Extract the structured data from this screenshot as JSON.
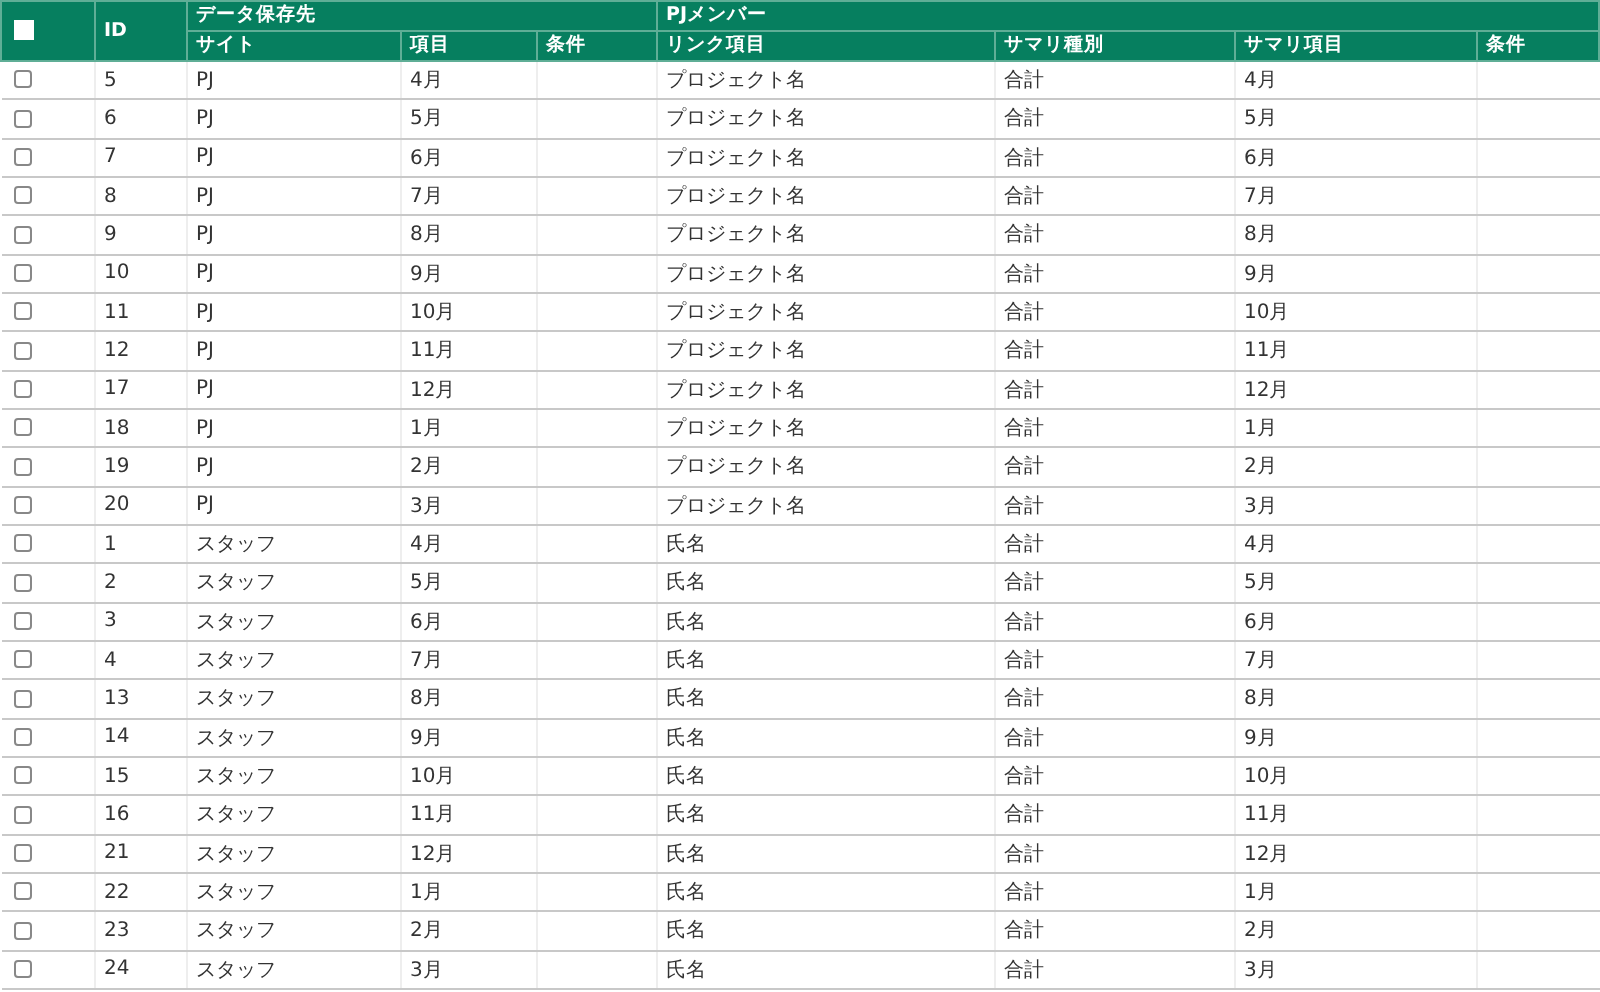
{
  "table": {
    "select_all": {
      "checked": false
    },
    "group_headers": [
      {
        "label": "データ保存先"
      },
      {
        "label": "PJメンバー"
      }
    ],
    "id_header": "ID",
    "columns": [
      "サイト",
      "項目",
      "条件",
      "リンク項目",
      "サマリ種別",
      "サマリ項目",
      "条件"
    ],
    "rows": [
      {
        "checked": false,
        "id": "5",
        "site": "PJ",
        "item": "4月",
        "link": "プロジェクト名",
        "summary_type": "合計",
        "summary_item": "4月"
      },
      {
        "checked": false,
        "id": "6",
        "site": "PJ",
        "item": "5月",
        "link": "プロジェクト名",
        "summary_type": "合計",
        "summary_item": "5月"
      },
      {
        "checked": false,
        "id": "7",
        "site": "PJ",
        "item": "6月",
        "link": "プロジェクト名",
        "summary_type": "合計",
        "summary_item": "6月"
      },
      {
        "checked": false,
        "id": "8",
        "site": "PJ",
        "item": "7月",
        "link": "プロジェクト名",
        "summary_type": "合計",
        "summary_item": "7月"
      },
      {
        "checked": false,
        "id": "9",
        "site": "PJ",
        "item": "8月",
        "link": "プロジェクト名",
        "summary_type": "合計",
        "summary_item": "8月"
      },
      {
        "checked": false,
        "id": "10",
        "site": "PJ",
        "item": "9月",
        "link": "プロジェクト名",
        "summary_type": "合計",
        "summary_item": "9月"
      },
      {
        "checked": false,
        "id": "11",
        "site": "PJ",
        "item": "10月",
        "link": "プロジェクト名",
        "summary_type": "合計",
        "summary_item": "10月"
      },
      {
        "checked": false,
        "id": "12",
        "site": "PJ",
        "item": "11月",
        "link": "プロジェクト名",
        "summary_type": "合計",
        "summary_item": "11月"
      },
      {
        "checked": false,
        "id": "17",
        "site": "PJ",
        "item": "12月",
        "link": "プロジェクト名",
        "summary_type": "合計",
        "summary_item": "12月"
      },
      {
        "checked": false,
        "id": "18",
        "site": "PJ",
        "item": "1月",
        "link": "プロジェクト名",
        "summary_type": "合計",
        "summary_item": "1月"
      },
      {
        "checked": false,
        "id": "19",
        "site": "PJ",
        "item": "2月",
        "link": "プロジェクト名",
        "summary_type": "合計",
        "summary_item": "2月"
      },
      {
        "checked": false,
        "id": "20",
        "site": "PJ",
        "item": "3月",
        "link": "プロジェクト名",
        "summary_type": "合計",
        "summary_item": "3月"
      },
      {
        "checked": false,
        "id": "1",
        "site": "スタッフ",
        "item": "4月",
        "link": "氏名",
        "summary_type": "合計",
        "summary_item": "4月"
      },
      {
        "checked": false,
        "id": "2",
        "site": "スタッフ",
        "item": "5月",
        "link": "氏名",
        "summary_type": "合計",
        "summary_item": "5月"
      },
      {
        "checked": false,
        "id": "3",
        "site": "スタッフ",
        "item": "6月",
        "link": "氏名",
        "summary_type": "合計",
        "summary_item": "6月"
      },
      {
        "checked": false,
        "id": "4",
        "site": "スタッフ",
        "item": "7月",
        "link": "氏名",
        "summary_type": "合計",
        "summary_item": "7月"
      },
      {
        "checked": false,
        "id": "13",
        "site": "スタッフ",
        "item": "8月",
        "link": "氏名",
        "summary_type": "合計",
        "summary_item": "8月"
      },
      {
        "checked": false,
        "id": "14",
        "site": "スタッフ",
        "item": "9月",
        "link": "氏名",
        "summary_type": "合計",
        "summary_item": "9月"
      },
      {
        "checked": false,
        "id": "15",
        "site": "スタッフ",
        "item": "10月",
        "link": "氏名",
        "summary_type": "合計",
        "summary_item": "10月"
      },
      {
        "checked": false,
        "id": "16",
        "site": "スタッフ",
        "item": "11月",
        "link": "氏名",
        "summary_type": "合計",
        "summary_item": "11月"
      },
      {
        "checked": false,
        "id": "21",
        "site": "スタッフ",
        "item": "12月",
        "link": "氏名",
        "summary_type": "合計",
        "summary_item": "12月"
      },
      {
        "checked": false,
        "id": "22",
        "site": "スタッフ",
        "item": "1月",
        "link": "氏名",
        "summary_type": "合計",
        "summary_item": "1月"
      },
      {
        "checked": false,
        "id": "23",
        "site": "スタッフ",
        "item": "2月",
        "link": "氏名",
        "summary_type": "合計",
        "summary_item": "2月"
      },
      {
        "checked": false,
        "id": "24",
        "site": "スタッフ",
        "item": "3月",
        "link": "氏名",
        "summary_type": "合計",
        "summary_item": "3月"
      }
    ]
  }
}
